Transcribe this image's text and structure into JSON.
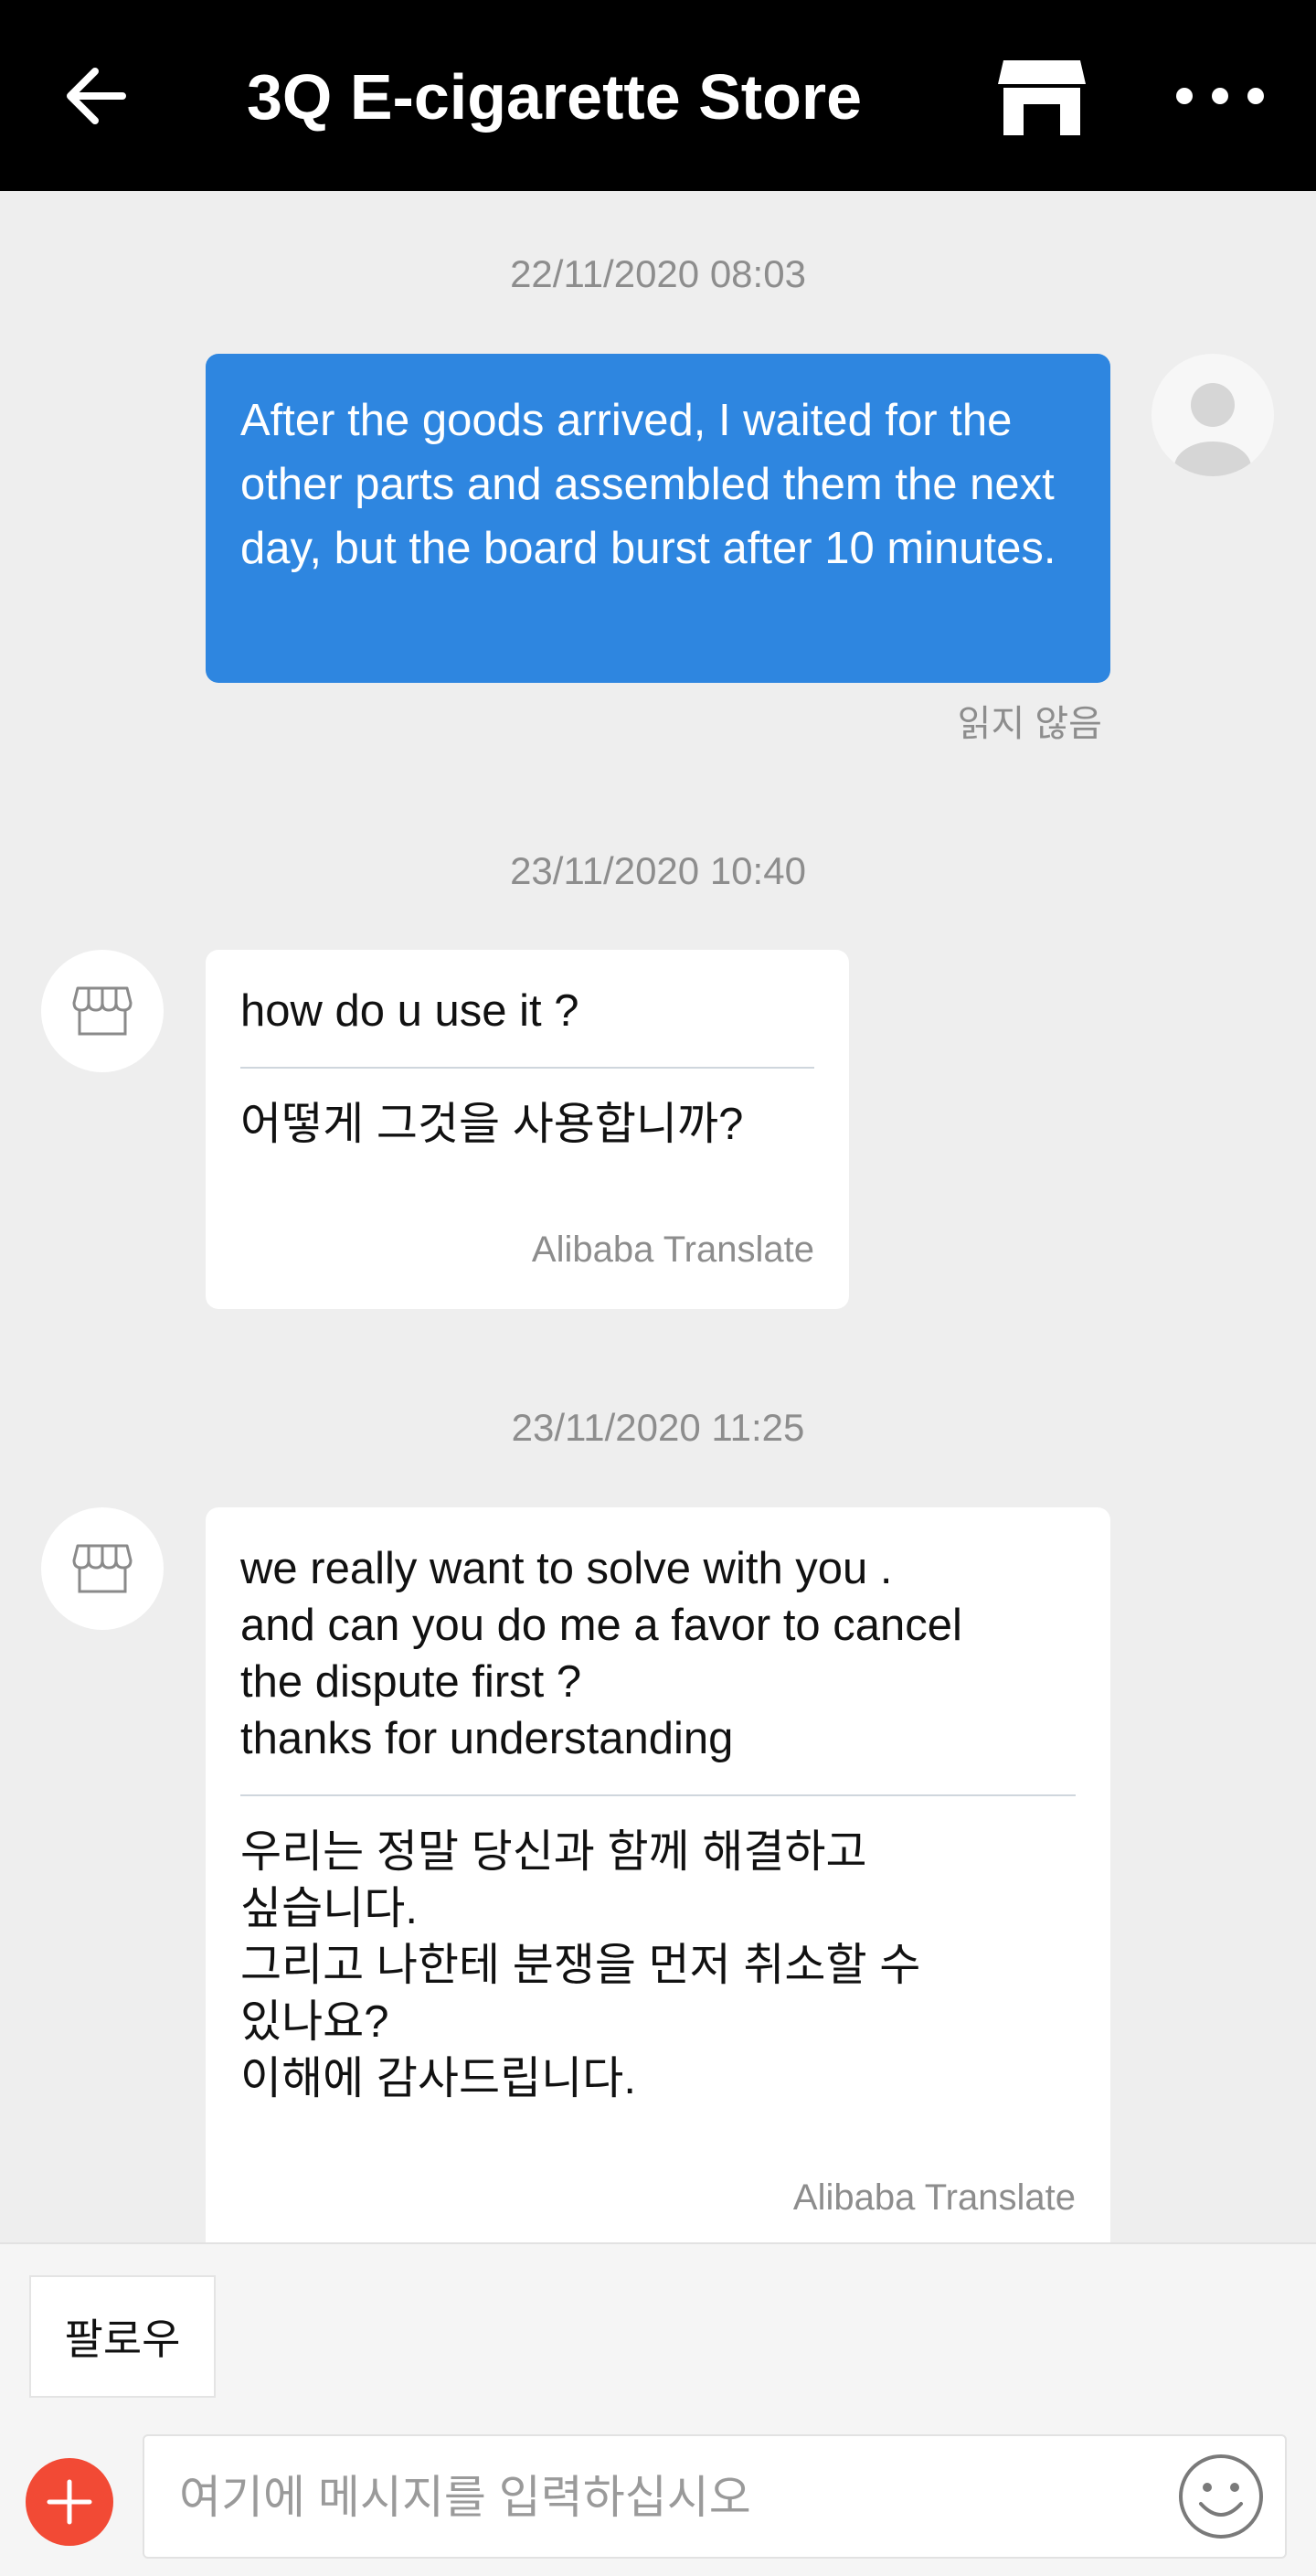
{
  "header": {
    "title": "3Q E-cigarette Store",
    "back_icon": "arrow-left-icon",
    "store_icon": "store-icon",
    "more_icon": "more-dots-icon"
  },
  "messages": [
    {
      "timestamp": "22/11/2020 08:03",
      "direction": "outgoing",
      "text": "After the goods arrived, I waited for the other parts and assembled them the next day, but the board burst after 10 minutes.",
      "status": "읽지 않음"
    },
    {
      "timestamp": "23/11/2020 10:40",
      "direction": "incoming",
      "text": "how do  u use it  ?",
      "translation": "어떻게 그것을 사용합니까?",
      "provider": "Alibaba Translate"
    },
    {
      "timestamp": "23/11/2020 11:25",
      "direction": "incoming",
      "text": "we really want to solve with you .\nand can you do me a favor to cancel\nthe dispute first ?\nthanks for understanding",
      "translation": "우리는 정말 당신과 함께 해결하고\n싶습니다.\n그리고 나한테 분쟁을 먼저 취소할 수\n있나요?\n이해에 감사드립니다.",
      "provider": "Alibaba Translate"
    }
  ],
  "bottom": {
    "follow_label": "팔로우",
    "input_placeholder": "여기에 메시지를 입력하십시오",
    "input_value": ""
  },
  "colors": {
    "header_bg": "#000000",
    "outgoing_bubble": "#2e86e0",
    "add_button": "#f24a35"
  }
}
